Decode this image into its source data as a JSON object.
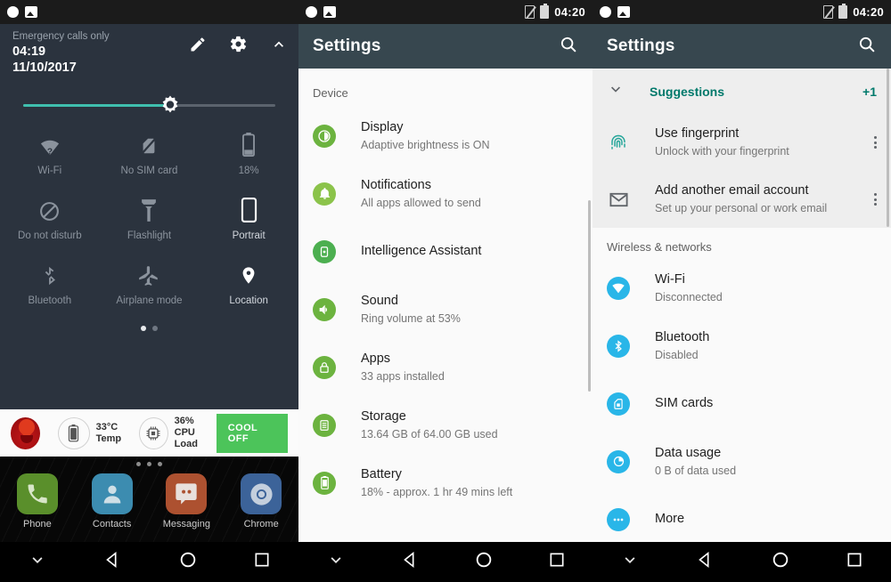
{
  "panel1": {
    "statusbar": {
      "icons": [
        "circle-icon",
        "photo-icon"
      ]
    },
    "carrier": "Emergency calls only",
    "time": "04:19",
    "date": "11/10/2017",
    "actions": [
      "edit-icon",
      "gear-icon",
      "collapse-icon"
    ],
    "brightness": {
      "value": 57
    },
    "tiles": [
      {
        "label": "Wi-Fi",
        "icon": "wifi-question-icon",
        "active": false
      },
      {
        "label": "No SIM card",
        "icon": "no-sim-icon",
        "active": false
      },
      {
        "label": "18%",
        "icon": "battery-icon",
        "active": false
      },
      {
        "label": "Do not disturb",
        "icon": "do-not-disturb-icon",
        "active": false
      },
      {
        "label": "Flashlight",
        "icon": "flashlight-icon",
        "active": false
      },
      {
        "label": "Portrait",
        "icon": "screen-rotation-icon",
        "active": true
      },
      {
        "label": "Bluetooth",
        "icon": "bluetooth-disabled-icon",
        "active": false
      },
      {
        "label": "Airplane mode",
        "icon": "airplane-off-icon",
        "active": false
      },
      {
        "label": "Location",
        "icon": "location-pin-icon",
        "active": true
      }
    ],
    "page_dots": 2,
    "page_active": 0,
    "booster": {
      "app_icon": "flame-icon",
      "temp_value": "33°C",
      "temp_label": "Temp",
      "cpu_value": "36%",
      "cpu_label": "CPU Load",
      "button": "COOL OFF",
      "button_color": "#4cc45a"
    },
    "home_dots": 3,
    "dock": [
      {
        "label": "Phone",
        "icon": "phone-icon",
        "color": "#5a8f2b"
      },
      {
        "label": "Contacts",
        "icon": "contacts-icon",
        "color": "#3c8cb0"
      },
      {
        "label": "Messaging",
        "icon": "messaging-icon",
        "color": "#ad5130"
      },
      {
        "label": "Chrome",
        "icon": "chrome-icon",
        "color": "#3c6399"
      }
    ],
    "navbar": [
      "collapse-icon",
      "back-icon",
      "home-icon",
      "recents-icon"
    ]
  },
  "panel2": {
    "statusbar": {
      "icons": [
        "circle-icon",
        "photo-icon"
      ],
      "sim": "no-sim-icon",
      "battery": "battery-icon",
      "time": "04:20"
    },
    "appbar": {
      "title": "Settings",
      "search_icon": "search-icon"
    },
    "section": "Device",
    "items": [
      {
        "title": "Display",
        "subtitle": "Adaptive brightness is ON",
        "icon": "display-icon",
        "color": "#6cb33f"
      },
      {
        "title": "Notifications",
        "subtitle": "All apps allowed to send",
        "icon": "notifications-icon",
        "color": "#8bc34a"
      },
      {
        "title": "Intelligence Assistant",
        "subtitle": "",
        "icon": "assistant-icon",
        "color": "#4caf50"
      },
      {
        "title": "Sound",
        "subtitle": "Ring volume at 53%",
        "icon": "sound-icon",
        "color": "#6cb33f"
      },
      {
        "title": "Apps",
        "subtitle": "33 apps installed",
        "icon": "apps-lock-icon",
        "color": "#6cb33f"
      },
      {
        "title": "Storage",
        "subtitle": "13.64 GB of 64.00 GB used",
        "icon": "storage-icon",
        "color": "#6cb33f"
      },
      {
        "title": "Battery",
        "subtitle": "18% - approx. 1 hr 49 mins left",
        "icon": "battery-settings-icon",
        "color": "#6cb33f"
      }
    ],
    "navbar": [
      "collapse-icon",
      "back-icon",
      "home-icon",
      "recents-icon"
    ]
  },
  "panel3": {
    "statusbar": {
      "icons": [
        "circle-icon",
        "photo-icon"
      ],
      "sim": "no-sim-icon",
      "battery": "battery-icon",
      "time": "04:20"
    },
    "appbar": {
      "title": "Settings",
      "search_icon": "search-icon"
    },
    "suggestions": {
      "header": "Suggestions",
      "count": "+1",
      "expand_icon": "chevron-down-icon",
      "accent": "#00796b",
      "items": [
        {
          "title": "Use fingerprint",
          "subtitle": "Unlock with your fingerprint",
          "icon": "fingerprint-icon",
          "color": "#26a69a"
        },
        {
          "title": "Add another email account",
          "subtitle": "Set up your personal or work email",
          "icon": "gmail-icon",
          "color": "#5f6368"
        }
      ]
    },
    "section": "Wireless & networks",
    "items": [
      {
        "title": "Wi-Fi",
        "subtitle": "Disconnected",
        "icon": "wifi-icon",
        "color": "#29b6e8"
      },
      {
        "title": "Bluetooth",
        "subtitle": "Disabled",
        "icon": "bluetooth-icon",
        "color": "#29b6e8"
      },
      {
        "title": "SIM cards",
        "subtitle": "",
        "icon": "sim-card-icon",
        "color": "#29b6e8"
      },
      {
        "title": "Data usage",
        "subtitle": "0 B of data used",
        "icon": "data-usage-icon",
        "color": "#29b6e8"
      },
      {
        "title": "More",
        "subtitle": "",
        "icon": "more-icon",
        "color": "#29b6e8"
      }
    ],
    "navbar": [
      "collapse-icon",
      "back-icon",
      "home-icon",
      "recents-icon"
    ]
  }
}
